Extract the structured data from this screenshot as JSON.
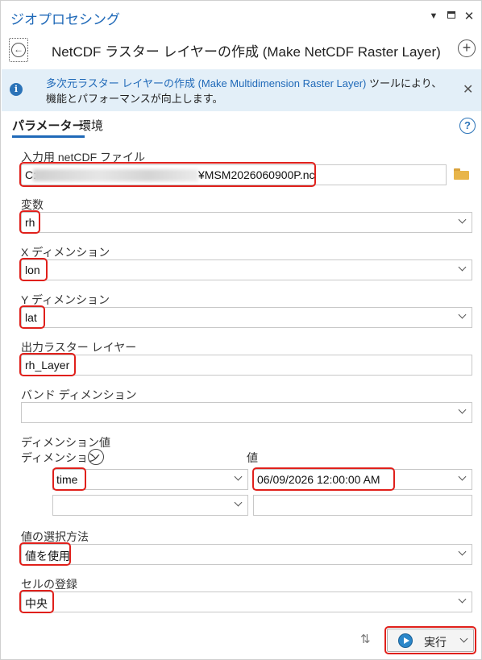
{
  "window": {
    "title": "ジオプロセシング",
    "controls": [
      "▾",
      "□",
      "✕"
    ]
  },
  "header": {
    "tool_title": "NetCDF ラスター レイヤーの作成 (Make NetCDF Raster Layer)"
  },
  "info": {
    "link_text": "多次元ラスター レイヤーの作成 (Make Multidimension Raster Layer)",
    "text_line1": " ツールにより、",
    "text_line2": "機能とパフォーマンスが向上します。"
  },
  "tabs": [
    {
      "label": "パラメーター"
    },
    {
      "label": "環境"
    }
  ],
  "params": {
    "input_file": {
      "label": "入力用 netCDF ファイル",
      "value_prefix": "C:",
      "value_suffix": "¥MSM2026060900P.nc"
    },
    "variable": {
      "label": "変数",
      "value": "rh"
    },
    "x_dim": {
      "label": "X ディメンション",
      "value": "lon"
    },
    "y_dim": {
      "label": "Y ディメンション",
      "value": "lat"
    },
    "output_layer": {
      "label": "出力ラスター レイヤー",
      "value": "rh_Layer"
    },
    "band_dim": {
      "label": "バンド ディメンション",
      "value": ""
    },
    "dim_values": {
      "label": "ディメンション値",
      "col_dimension": "ディメンション",
      "col_value": "値",
      "rows": [
        {
          "dimension": "time",
          "value": "06/09/2026 12:00:00 AM"
        },
        {
          "dimension": "",
          "value": ""
        }
      ]
    },
    "selection_method": {
      "label": "値の選択方法",
      "value": "値を使用"
    },
    "cell_registration": {
      "label": "セルの登録",
      "value": "中央"
    }
  },
  "footer": {
    "run_label": "実行"
  },
  "colors": {
    "accent": "#1f69b8",
    "highlight": "#e0201b",
    "banner": "#e3eff8"
  }
}
